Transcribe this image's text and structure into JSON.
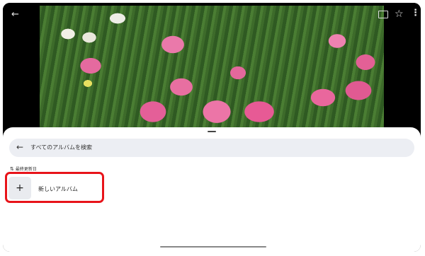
{
  "viewer": {
    "back_icon": "arrow-left-icon",
    "cast_icon": "cast-icon",
    "favorite_icon": "star-outline-icon",
    "more_icon": "more-vert-icon",
    "photo": "pink-tulips"
  },
  "sheet": {
    "search": {
      "label": "すべてのアルバムを検索",
      "back_icon": "arrow-left-icon"
    },
    "sort_label": "最終更新日",
    "new_album": {
      "icon": "plus-icon",
      "label": "新しいアルバム"
    }
  },
  "colors": {
    "highlight": "#e8141a",
    "search_bg": "#eceef3"
  }
}
